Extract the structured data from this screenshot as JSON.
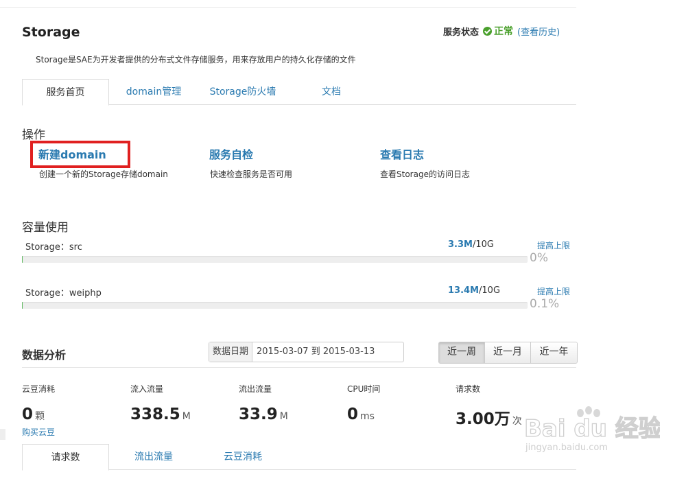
{
  "header": {
    "title": "Storage",
    "status_label": "服务状态",
    "status_value": "正常",
    "history_link": "(查看历史)",
    "description": "Storage是SAE为开发者提供的分布式文件存储服务，用来存放用户的持久化存储的文件"
  },
  "tabs": [
    {
      "label": "服务首页",
      "active": true
    },
    {
      "label": "domain管理",
      "active": false
    },
    {
      "label": "Storage防火墙",
      "active": false
    },
    {
      "label": "文档",
      "active": false
    }
  ],
  "operations": {
    "heading": "操作",
    "items": [
      {
        "title": "新建domain",
        "desc": "创建一个新的Storage存储domain"
      },
      {
        "title": "服务自检",
        "desc": "快速检查服务是否可用"
      },
      {
        "title": "查看日志",
        "desc": "查看Storage的访问日志"
      }
    ]
  },
  "capacity": {
    "heading": "容量使用",
    "items": [
      {
        "label": "Storage：src",
        "used": "3.3M",
        "total": "/10G",
        "action": "提高上限",
        "percent": "0%",
        "fill_percent": 0
      },
      {
        "label": "Storage：weiphp",
        "used": "13.4M",
        "total": "/10G",
        "action": "提高上限",
        "percent": "0.1%",
        "fill_percent": 0.1
      }
    ]
  },
  "analysis": {
    "heading": "数据分析",
    "date_label": "数据日期",
    "date_value": "2015-03-07 到 2015-03-13",
    "ranges": [
      {
        "label": "近一周",
        "active": true
      },
      {
        "label": "近一月",
        "active": false
      },
      {
        "label": "近一年",
        "active": false
      }
    ],
    "metrics": [
      {
        "label": "云豆消耗",
        "value": "0",
        "unit": "颗"
      },
      {
        "label": "流入流量",
        "value": "338.5",
        "unit": "M"
      },
      {
        "label": "流出流量",
        "value": "33.9",
        "unit": "M"
      },
      {
        "label": "CPU时间",
        "value": "0",
        "unit": "ms"
      },
      {
        "label": "请求数",
        "value": "3.00万",
        "unit": "次"
      }
    ],
    "buy_link": "购买云豆"
  },
  "chart_tabs": [
    {
      "label": "请求数",
      "active": true
    },
    {
      "label": "流出流量",
      "active": false
    },
    {
      "label": "云豆消耗",
      "active": false
    }
  ],
  "watermark": {
    "brand": "Bai du 经验",
    "url": "jingyan.baidu.com"
  },
  "colors": {
    "link": "#2a7ab0",
    "ok": "#4aa02c",
    "highlight": "#e02020",
    "bar_fill": "#5cb85c"
  }
}
